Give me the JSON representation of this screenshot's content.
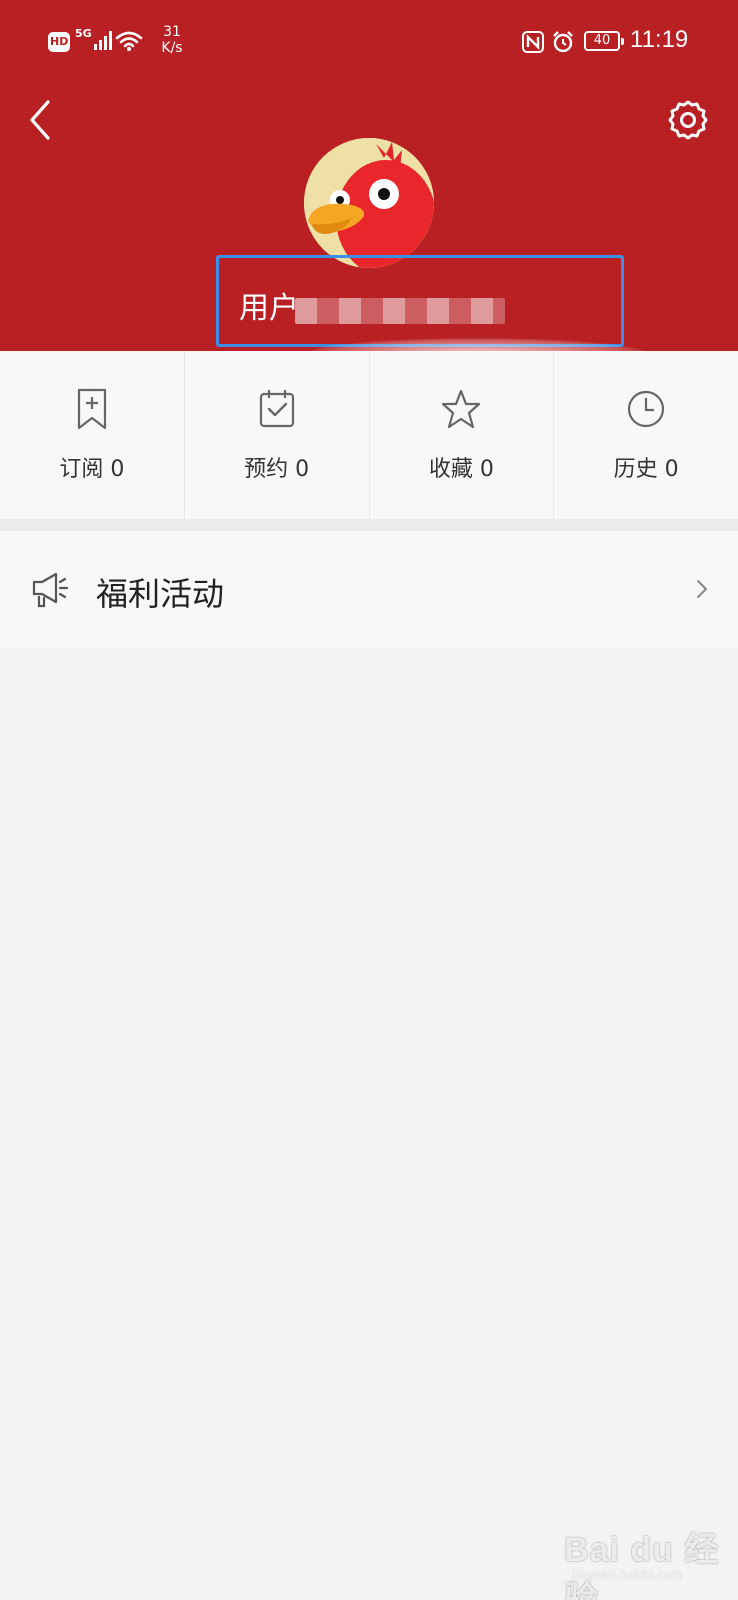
{
  "status_bar": {
    "hd": "HD",
    "network": "5G",
    "speed_value": "31",
    "speed_unit": "K/s",
    "battery": "40",
    "time": "11:19"
  },
  "header": {
    "back_icon": "chevron-left-icon",
    "settings_icon": "gear-icon",
    "background_color": "#b82024"
  },
  "profile": {
    "username_prefix": "用户",
    "highlight_color": "#3d8fe6"
  },
  "stats": [
    {
      "icon": "bookmark-plus-icon",
      "label": "订阅",
      "count": "0"
    },
    {
      "icon": "calendar-check-icon",
      "label": "预约",
      "count": "0"
    },
    {
      "icon": "star-icon",
      "label": "收藏",
      "count": "0"
    },
    {
      "icon": "clock-icon",
      "label": "历史",
      "count": "0"
    }
  ],
  "menu": {
    "welfare_label": "福利活动",
    "welfare_icon": "megaphone-icon"
  },
  "watermark": {
    "main": "Bai du 经验",
    "sub": "jingyan.baidu.com"
  }
}
